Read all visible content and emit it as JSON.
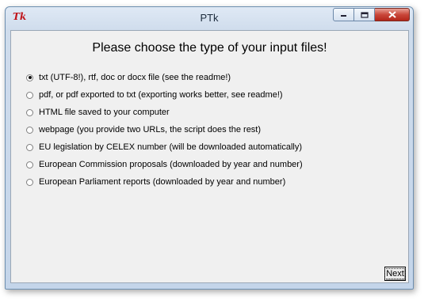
{
  "window": {
    "title": "PTk",
    "app_icon_glyph": "Tk",
    "icons": [
      "app-icon",
      "minimize-icon",
      "maximize-icon",
      "close-icon"
    ]
  },
  "heading": "Please choose the type of your input files!",
  "options": [
    {
      "label": "txt (UTF-8!), rtf, doc or docx file (see the readme!)",
      "selected": true
    },
    {
      "label": "pdf, or pdf exported to txt (exporting works better, see readme!)",
      "selected": false
    },
    {
      "label": "HTML file saved to your computer",
      "selected": false
    },
    {
      "label": "webpage (you provide two URLs, the script does the rest)",
      "selected": false
    },
    {
      "label": "EU legislation by CELEX number (will be downloaded automatically)",
      "selected": false
    },
    {
      "label": "European Commission proposals (downloaded by year and number)",
      "selected": false
    },
    {
      "label": "European Parliament reports (downloaded by year and number)",
      "selected": false
    }
  ],
  "buttons": {
    "next_label": "Next"
  },
  "colors": {
    "client_bg": "#f0f0f0",
    "close_button": "#c9473a",
    "icon_red": "#c0141a"
  }
}
